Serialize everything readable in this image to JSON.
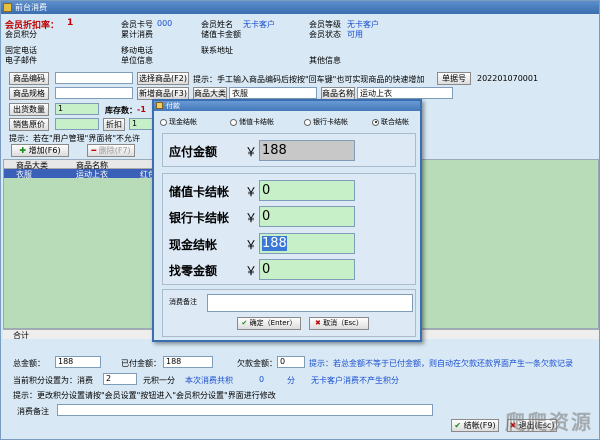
{
  "window": {
    "title": "前台消费"
  },
  "member": {
    "rate_label": "会员折扣率：",
    "rate_value": "1",
    "card_no_label": "会员卡号",
    "card_no_value": "000",
    "name_label": "会员姓名",
    "name_value": "无卡客户",
    "level_label": "会员等级",
    "level_value": "无卡客户",
    "points_label": "会员积分",
    "total_consume_label": "累计消费",
    "stored_amount_label": "储值卡金额",
    "status_label": "会员状态",
    "status_value": "可用",
    "phone_label": "固定电话",
    "mobile_label": "移动电话",
    "address_label": "联系地址",
    "email_label": "电子邮件",
    "company_label": "单位信息",
    "other_label": "其他信息"
  },
  "toolbar": {
    "product_code_label": "商品编码",
    "select_product_button": "选择商品(F2)",
    "hint": "提示：手工输入商品编码后按按\"回车键\"也可实现商品的快速增加",
    "order_no_label": "单据号",
    "order_no_value": "202201070001",
    "product_spec_label": "商品规格",
    "new_product_button": "新增商品(F3)",
    "category_label": "商品大类",
    "category_value": "衣服",
    "product_name_label": "商品名称",
    "product_name_value": "运动上衣",
    "qty_label": "出货数量",
    "qty_value": "1",
    "stock_label": "库存数：",
    "stock_value": "-1",
    "price_label": "销售原价",
    "discount_label": "折扣",
    "discount_value": "1",
    "manage_hint": "提示：若在\"用户管理\"界面将\"不允许",
    "add_button": "增加(F6)",
    "delete_button": "删除(F7)"
  },
  "grid": {
    "columns": [
      "商品大类",
      "商品名称",
      "红色"
    ],
    "rows": [
      [
        "衣服",
        "运动上衣",
        "红色"
      ]
    ],
    "totals_label": "合计"
  },
  "bottom": {
    "total_amount_label": "总金额：",
    "total_amount_value": "188",
    "paid_label": "已付金额：",
    "paid_value": "188",
    "owed_label": "欠款金额：",
    "owed_value": "0",
    "owed_hint": "提示：若总金额不等于已付金额，则自动在欠款还款界面产生一条欠款记录",
    "points_setting_label": "当前积分设置为：消费",
    "points_setting_value": "2",
    "points_unit": "元积一分",
    "this_points_label": "本次消费共积",
    "this_points_value": "0",
    "points_suffix": "分",
    "no_card_hint": "无卡客户消费不产生积分",
    "change_hint": "提示：更改积分设置请按\"会员设置\"按钮进入\"会员积分设置\"界面进行修改",
    "remark_label": "消费备注",
    "checkout_button": "结帐(F9)",
    "cancel_button": "退出(Esc)"
  },
  "modal": {
    "title": "付款",
    "radios": [
      "现金结帐",
      "储值卡结帐",
      "银行卡结帐",
      "联合结帐"
    ],
    "selected_radio": 3,
    "due_label": "应付金额",
    "currency": "￥",
    "due_value": "188",
    "stored_label": "储值卡结帐",
    "stored_value": "0",
    "bank_label": "银行卡结帐",
    "bank_value": "0",
    "cash_label": "现金结帐",
    "cash_value": "188",
    "change_label": "找零金额",
    "change_value": "0",
    "remark_label": "消费备注",
    "ok_button": "确定（Enter）",
    "cancel_button": "取消（Esc）"
  },
  "watermark": "爬爬资源"
}
